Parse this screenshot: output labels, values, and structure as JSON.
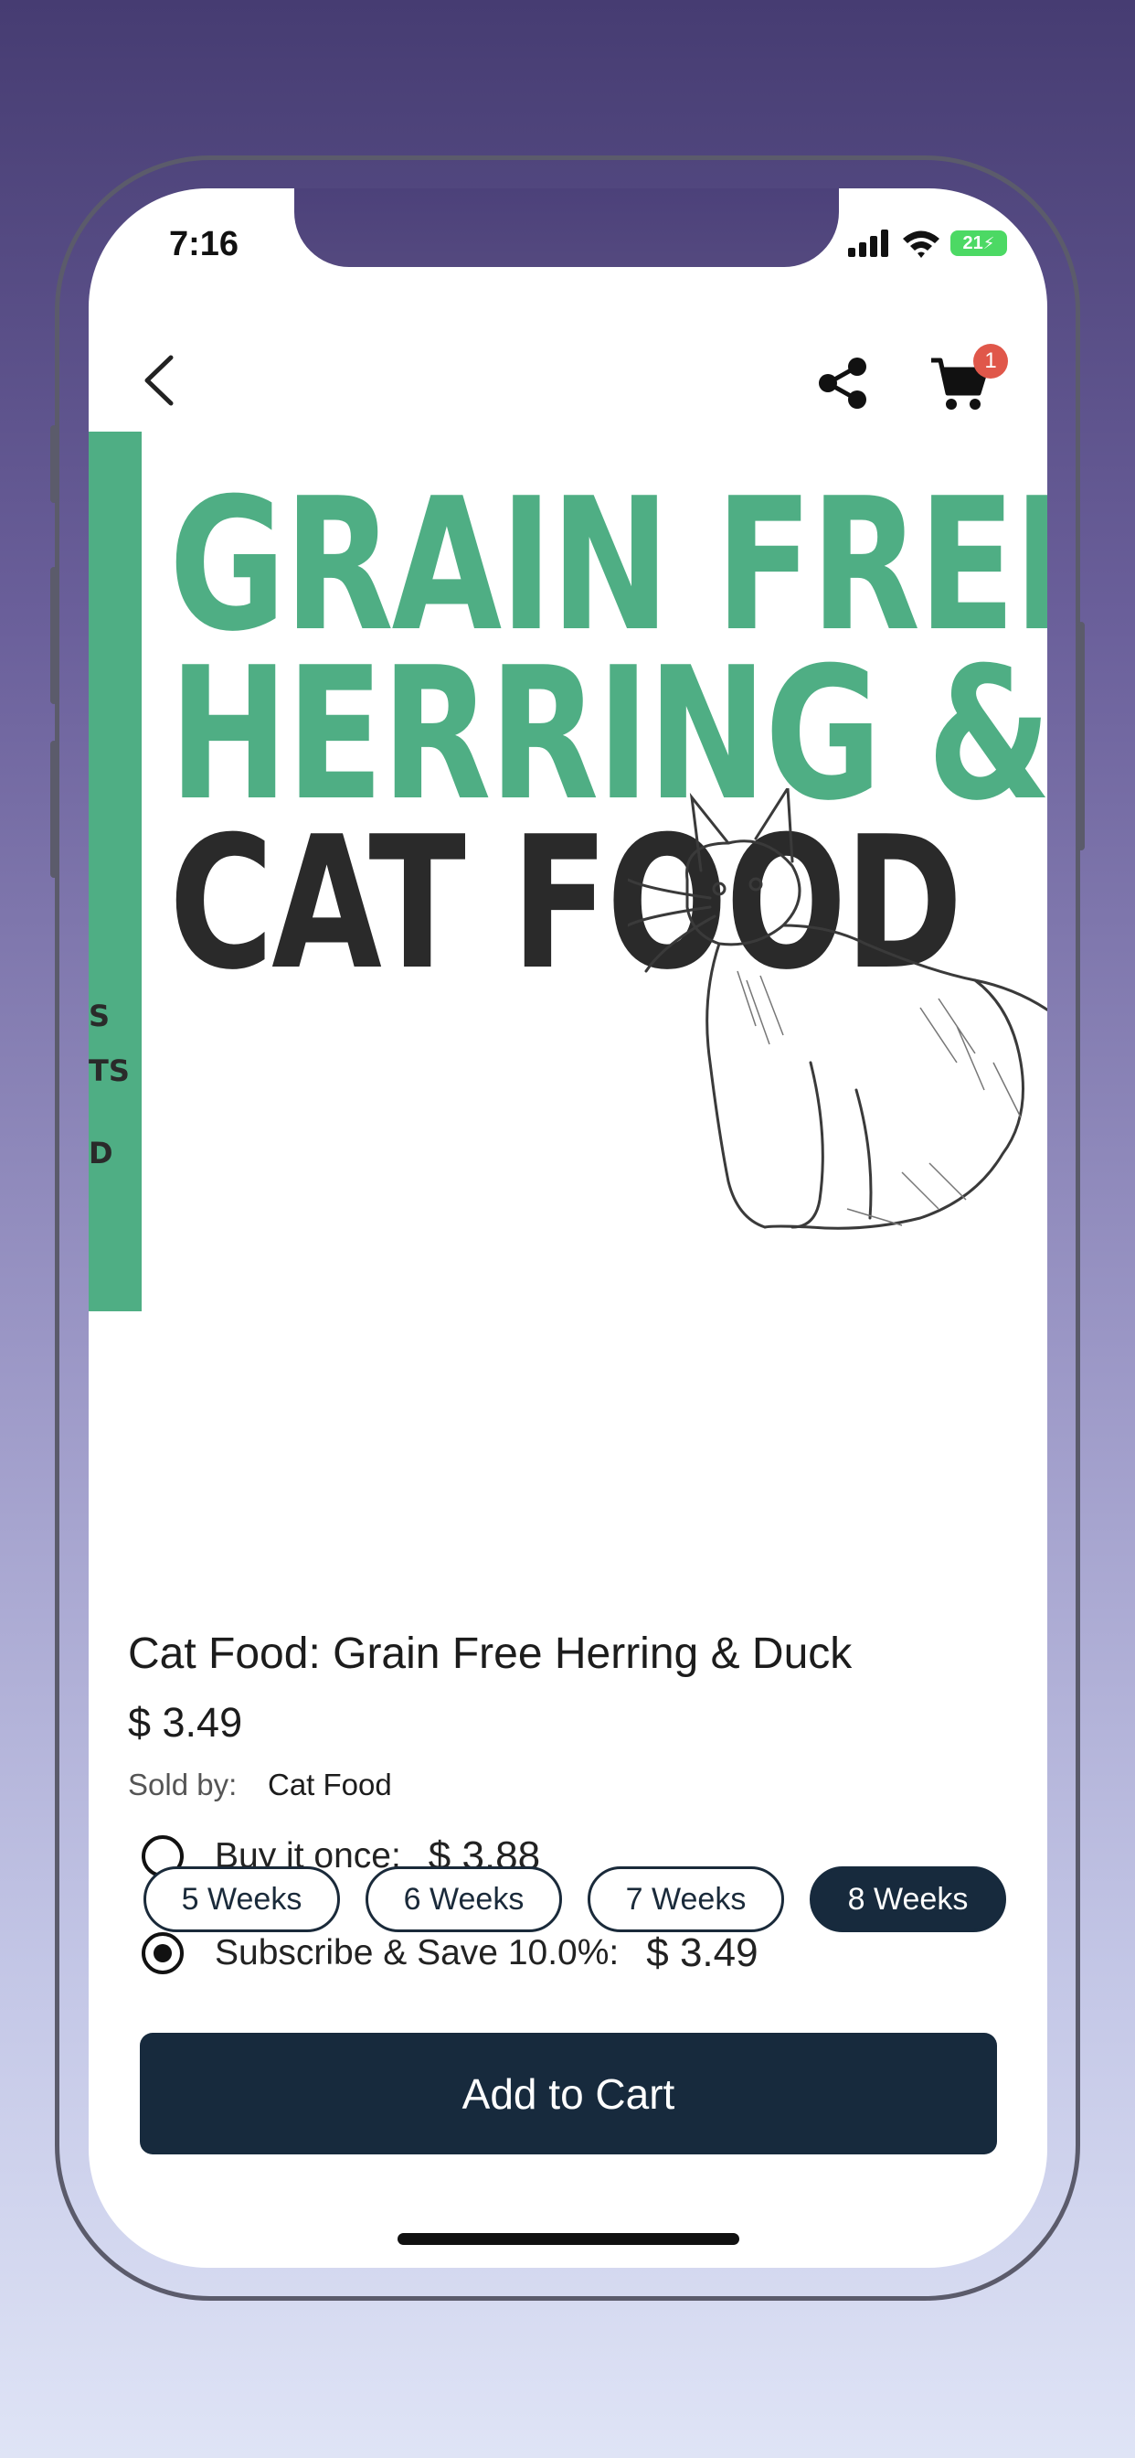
{
  "status": {
    "time": "7:16",
    "battery": "21"
  },
  "nav": {
    "cart_count": "1"
  },
  "product_image": {
    "headline_line1": "GRAIN FREE",
    "headline_line2": "HERRING & DUCK",
    "headline_line3": "CAT FOOD",
    "side_text_1": "S",
    "side_text_2": "TS",
    "side_text_3": "D",
    "accent_color": "#4fae84"
  },
  "product": {
    "title": "Cat Food: Grain Free Herring & Duck",
    "price": "$ 3.49",
    "sold_by_label": "Sold by:",
    "seller": "Cat Food"
  },
  "purchase_options": {
    "once": {
      "label": "Buy it once:",
      "price": "$ 3.88",
      "selected": false
    },
    "subscribe": {
      "label": "Subscribe & Save 10.0%:",
      "price": "$ 3.49",
      "selected": true
    }
  },
  "frequencies": [
    {
      "label": "5 Weeks",
      "selected": false
    },
    {
      "label": "6 Weeks",
      "selected": false
    },
    {
      "label": "7 Weeks",
      "selected": false
    },
    {
      "label": "8 Weeks",
      "selected": true
    }
  ],
  "add_to_cart_label": "Add to Cart",
  "colors": {
    "primary_dark": "#172a3d",
    "badge": "#e0574a"
  }
}
